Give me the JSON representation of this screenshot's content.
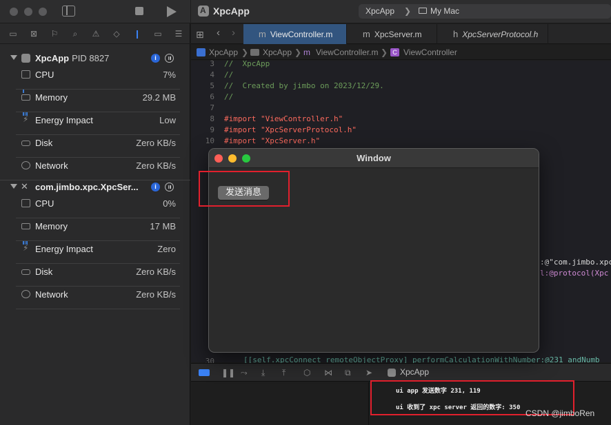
{
  "navigator": {
    "processes": [
      {
        "name": "XpcApp",
        "pid": "PID 8827",
        "gauges": [
          {
            "label": "CPU",
            "value": "7%"
          },
          {
            "label": "Memory",
            "value": "29.2 MB"
          },
          {
            "label": "Energy Impact",
            "value": "Low"
          },
          {
            "label": "Disk",
            "value": "Zero KB/s"
          },
          {
            "label": "Network",
            "value": "Zero KB/s"
          }
        ]
      },
      {
        "name": "com.jimbo.xpc.XpcSer...",
        "pid": "",
        "gauges": [
          {
            "label": "CPU",
            "value": "0%"
          },
          {
            "label": "Memory",
            "value": "17 MB"
          },
          {
            "label": "Energy Impact",
            "value": "Zero"
          },
          {
            "label": "Disk",
            "value": "Zero KB/s"
          },
          {
            "label": "Network",
            "value": "Zero KB/s"
          }
        ]
      }
    ]
  },
  "toolbar": {
    "app_title": "XpcApp",
    "scheme": "XpcApp",
    "separator": "❯",
    "destination": "My Mac"
  },
  "tabs": [
    {
      "kind": "m",
      "label": "ViewController.m"
    },
    {
      "kind": "m",
      "label": "XpcServer.m"
    },
    {
      "kind": "h",
      "label": "XpcServerProtocol.h"
    }
  ],
  "jumpbar": {
    "project": "XpcApp",
    "group": "XpcApp",
    "file": "ViewController.m",
    "symbol": "ViewController"
  },
  "code": {
    "lines": [
      {
        "n": "3",
        "text": "//  XpcApp"
      },
      {
        "n": "4",
        "text": "//"
      },
      {
        "n": "5",
        "text": "//  Created by jimbo on 2023/12/29."
      },
      {
        "n": "6",
        "text": "//"
      },
      {
        "n": "7",
        "text": ""
      },
      {
        "n": "8",
        "text": "#import \"ViewController.h\""
      },
      {
        "n": "9",
        "text": "#import \"XpcServerProtocol.h\""
      },
      {
        "n": "10",
        "text": "#import \"XpcServer.h\""
      }
    ],
    "fragment_1": ":@\"com.jimbo.xpc",
    "fragment_2": "l:@protocol(Xpc",
    "fragment_3a": "[[self.xpcConnect remoteObjectProxy] performCalculationWithNumber:@231 andNumb",
    "fragment_3n": "30"
  },
  "debug": {
    "target": "XpcApp"
  },
  "console": {
    "lines": [
      "ui app 发送数字 231, 119",
      "ui 收到了 xpc server 返回的数字: 350"
    ]
  },
  "window": {
    "title": "Window",
    "send_button": "发送消息"
  },
  "watermark": "CSDN @jimboRen",
  "colors": {
    "accent": "#3b83f7",
    "highlight_box": "#e2202d",
    "close": "#ff5f57",
    "minimize": "#febc2e",
    "zoom": "#28c840"
  }
}
